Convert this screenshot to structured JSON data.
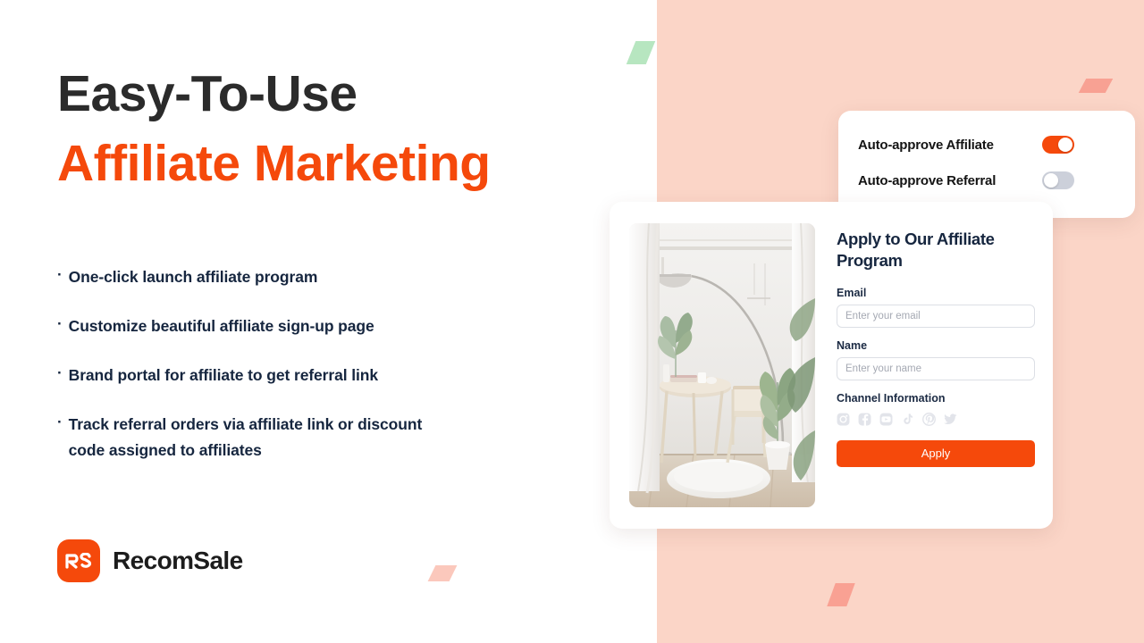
{
  "headline": {
    "line1": "Easy-To-Use",
    "line2": "Affiliate Marketing"
  },
  "bullets": [
    {
      "mark": "·",
      "text": "One-click launch affiliate program"
    },
    {
      "mark": "·",
      "text": "Customize beautiful affiliate sign-up page"
    },
    {
      "mark": "·",
      "text": "Brand portal for affiliate to get referral link"
    },
    {
      "mark": "·",
      "text": "Track referral orders via affiliate link or discount code assigned to affiliates"
    }
  ],
  "logo": {
    "mark_text": "RS",
    "name": "RecomSale",
    "mark_color": "#f5490b",
    "name_color": "#1c1c1c"
  },
  "toggle_card": {
    "rows": [
      {
        "label": "Auto-approve Affiliate",
        "state": "on",
        "on_color": "#f5490b"
      },
      {
        "label": "Auto-approve Referral",
        "state": "off",
        "off_color": "#ccd0da"
      }
    ]
  },
  "apply_card": {
    "photo_alt": "minimalist white interior room with arc lamp, round table, chair, plants and round rug",
    "title": "Apply to Our Affiliate Program",
    "fields": [
      {
        "label": "Email",
        "placeholder": "Enter your email",
        "value": ""
      },
      {
        "label": "Name",
        "placeholder": "Enter your name",
        "value": ""
      }
    ],
    "channel_label": "Channel Information",
    "socials": [
      "instagram-icon",
      "facebook-icon",
      "youtube-icon",
      "tiktok-icon",
      "pinterest-icon",
      "twitter-icon"
    ],
    "apply_button": "Apply"
  },
  "theme": {
    "accent_orange": "#f5490b",
    "peach_panel": "#fbd5c7",
    "headline_dark": "#2b2b2b",
    "body_navy": "#16263f",
    "white": "#ffffff"
  },
  "decorations": [
    {
      "name": "green-parallelogram",
      "color": "#b7e6c0"
    },
    {
      "name": "salmon-parallelogram-top-right",
      "color": "#f8a193"
    },
    {
      "name": "pink-parallelogram-bottom-left",
      "color": "#fbc8bc"
    },
    {
      "name": "salmon-parallelogram-bottom",
      "color": "#f9a193"
    }
  ]
}
